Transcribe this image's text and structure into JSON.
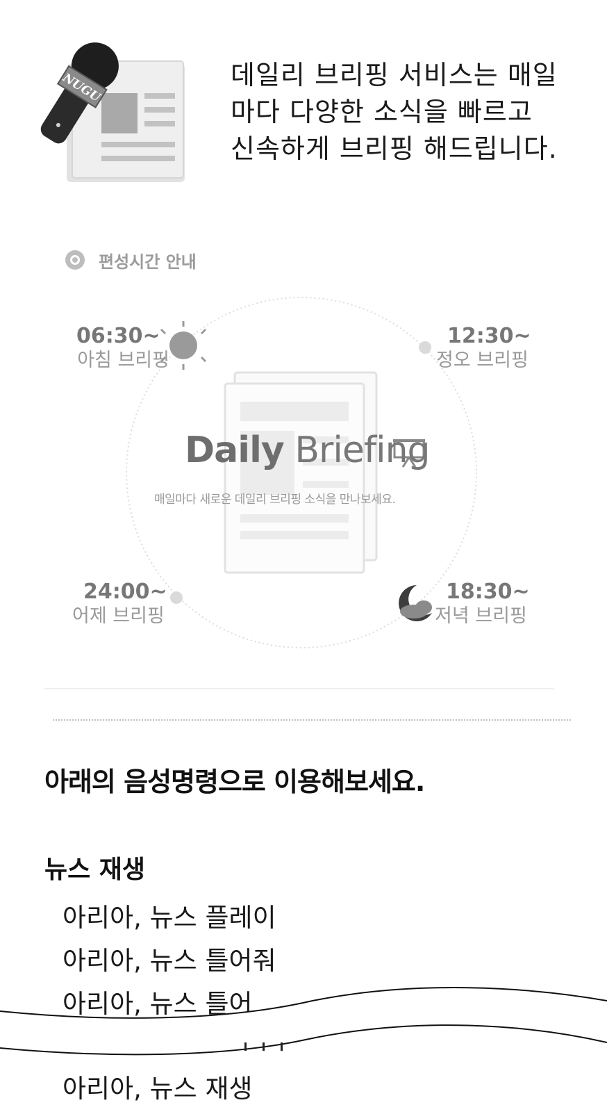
{
  "intro": {
    "icon": "newspaper-microphone-icon",
    "mic_badge": "NUGU",
    "lines": [
      "데일리 브리핑 서비스는 매일",
      "마다 다양한 소식을 빠르고",
      "신속하게 브리핑 해드립니다."
    ]
  },
  "schedule": {
    "header": "편성시간 안내",
    "brand_bold": "Daily",
    "brand_light": "Briefing",
    "brand_icon": "presentation-board-icon",
    "subtitle": "매일마다 새로운 데일리 브리핑 소식을 만나보세요.",
    "slots": [
      {
        "time": "06:30~",
        "label": "아침 브리핑",
        "icon": "sun-icon"
      },
      {
        "time": "12:30~",
        "label": "정오 브리핑"
      },
      {
        "time": "24:00~",
        "label": "어제 브리핑"
      },
      {
        "time": "18:30~",
        "label": "저녁 브리핑",
        "icon": "moon-cloud-icon"
      }
    ]
  },
  "commands": {
    "heading": "아래의 음성명령으로 이용해보세요.",
    "group_title": "뉴스 재생",
    "items": [
      "아리아, 뉴스 플레이",
      "아리아, 뉴스 틀어줘",
      "아리아, 뉴스 틀어",
      "아리아, 뉴스 재생"
    ]
  },
  "colors": {
    "text": "#111111",
    "muted": "#9a9a9a",
    "illustration": "#bdbdbd"
  }
}
